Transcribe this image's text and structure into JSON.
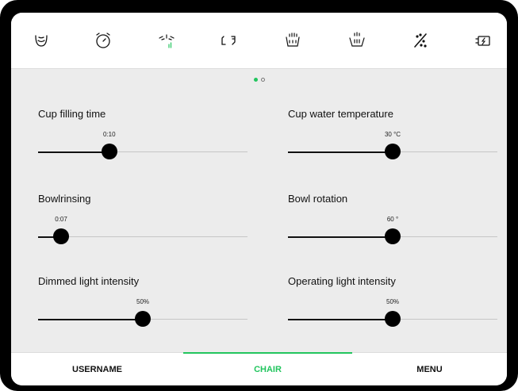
{
  "colors": {
    "accent": "#22c55e",
    "track": "#c6c6c6",
    "knob": "#000000"
  },
  "toolbar": {
    "icons": [
      "spittoon-icon",
      "timer-icon",
      "water-spray-icon",
      "chair-position-icon",
      "cup-fill-icon",
      "bowl-rinse-icon",
      "disinfection-icon",
      "power-icon"
    ]
  },
  "pager": {
    "current": 1,
    "total": 2
  },
  "settings": {
    "cup_filling_time": {
      "label": "Cup filling time",
      "value": "0:10",
      "level": 0.34
    },
    "cup_water_temperature": {
      "label": "Cup water temperature",
      "value": "30 °C",
      "level": 0.5
    },
    "bowl_rinsing": {
      "label": "Bowlrinsing",
      "value": "0:07",
      "level": 0.11
    },
    "bowl_rotation": {
      "label": "Bowl rotation",
      "value": "60 °",
      "level": 0.5
    },
    "dimmed_light_intensity": {
      "label": "Dimmed light intensity",
      "value": "50%",
      "level": 0.5
    },
    "operating_light_intensity": {
      "label": "Operating light intensity",
      "value": "50%",
      "level": 0.5
    }
  },
  "nav": {
    "username": "USERNAME",
    "chair": "CHAIR",
    "menu": "MENU",
    "active": "chair"
  }
}
